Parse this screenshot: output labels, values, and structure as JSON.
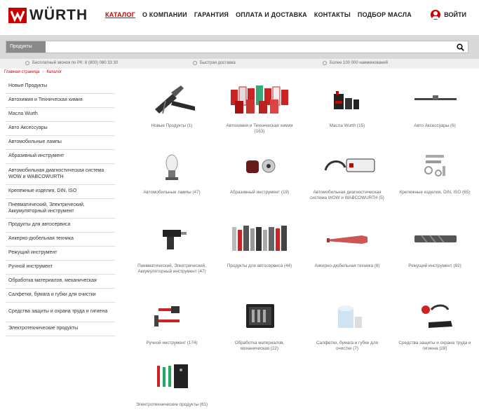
{
  "header": {
    "logo_text": "WÜRTH",
    "nav": [
      "КАТАЛОГ",
      "О КОМПАНИИ",
      "ГАРАНТИЯ",
      "ОПЛАТА И ДОСТАВКА",
      "КОНТАКТЫ",
      "ПОДБОР МАСЛА"
    ],
    "login_label": "ВОЙТИ"
  },
  "search": {
    "category": "Продукты",
    "value": "",
    "placeholder": ""
  },
  "info": {
    "phone": "Бесплатный звонок по РК: 8 (800) 080 33 30",
    "delivery": "Быстрая доставка",
    "items": "Более 100 000 наименований"
  },
  "breadcrumb": {
    "home": "Главная страница",
    "current": "Каталог"
  },
  "sidebar": {
    "items": [
      "Новые Продукты",
      "Автохимия и Техническая химия",
      "Масла Wurth",
      "Авто Аксессуары",
      "Автомобильные лампы",
      "Абразивный инструмент",
      "Автомобильная диагностическая система WOW и WABCOWURTH",
      "Крепежные изделия, DIN, ISO",
      "Пневматический, Электрический, Аккумуляторный инструмент",
      "Продукты для автосервиса",
      "Анкерно-дюбельная техника",
      "Режущий инструмент",
      "Ручной инструмент",
      "Обработка материалов, механическая",
      "Салфетки, бумага и губки для очистки",
      "Средства защиты и охрана труда и гигиена",
      "Электротехнические продукты"
    ]
  },
  "catalog": {
    "cards": [
      "Новые Продукты (1)",
      "Автохимия и Техническая химия (163)",
      "Масла Wurth (15)",
      "Авто Аксессуары (6)",
      "Автомобильные лампы (47)",
      "Абразивный инструмент (19)",
      "Автомобильная диагностическая система WOW и WABCOWURTH (5)",
      "Крепежные изделия, DIN, ISO (65)",
      "Пневматический, Электрический, Аккумуляторный инструмент (47)",
      "Продукты для автосервиса (44)",
      "Анкерно-дюбельная техника (8)",
      "Режущий инструмент (92)",
      "Ручной инструмент (174)",
      "Обработка материалов, механическая (22)",
      "Салфетки, бумага и губки для очистки (7)",
      "Средства защиты и охрана труда и гигиена (28)",
      "Электротехнические продукты (61)"
    ]
  },
  "colors": {
    "brand_red": "#cc0000",
    "searchbar_bg": "#d9d9d9"
  }
}
